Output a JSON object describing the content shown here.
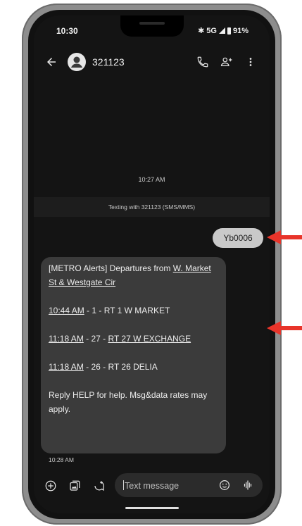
{
  "status_bar": {
    "time": "10:30",
    "network": "5G",
    "battery": "91%"
  },
  "header": {
    "contact_name": "321123"
  },
  "conversation": {
    "date_time": "10:27 AM",
    "texting_with": "Texting with 321123 (SMS/MMS)",
    "sent_message": "Yb0006",
    "received": {
      "prefix": "[METRO Alerts] Departures from ",
      "stop_link": "W. Market St & Westgate Cir",
      "departures": [
        {
          "time": "10:44 AM",
          "route": " - 1 - ",
          "name": "RT 1 W MARKET",
          "name_underlined": false
        },
        {
          "time": "11:18 AM",
          "route": " - 27 - ",
          "name": "RT 27 W EXCHANGE",
          "name_underlined": true
        },
        {
          "time": "11:18 AM",
          "route": " - 26 - ",
          "name": "RT 26 DELIA",
          "name_underlined": false
        }
      ],
      "footer": "Reply HELP for help. Msg&data rates may apply."
    },
    "received_time": "10:28 AM"
  },
  "compose": {
    "placeholder": "Text message"
  },
  "colors": {
    "background": "#141414",
    "received_bubble": "#3b3b3b",
    "sent_bubble": "#c9c9c9",
    "annotation_arrow": "#e8342a"
  },
  "icons": [
    "back-arrow-icon",
    "avatar-person-icon",
    "phone-icon",
    "add-person-icon",
    "more-vert-icon",
    "add-circle-icon",
    "gallery-icon",
    "sticker-icon",
    "emoji-icon",
    "voice-icon"
  ]
}
